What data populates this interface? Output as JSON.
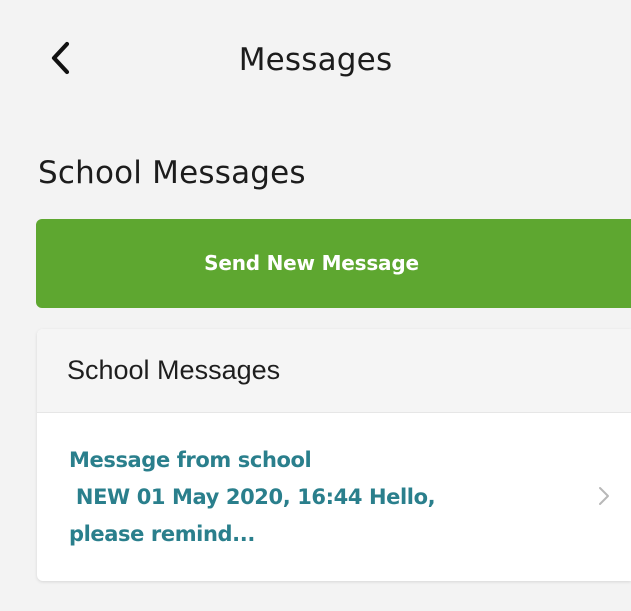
{
  "nav": {
    "title": "Messages"
  },
  "section": {
    "title": "School Messages"
  },
  "send_button": {
    "label": "Send New Message",
    "color": "#5ea730"
  },
  "messages_card": {
    "header": "School Messages",
    "items": [
      {
        "line1": "Message from school",
        "line2": " NEW 01 May 2020, 16:44 Hello,",
        "line3": "please remind...",
        "color": "#2a7f8c"
      }
    ]
  },
  "icons": {
    "back": "chevron-left-icon",
    "item_arrow": "chevron-right-icon"
  }
}
